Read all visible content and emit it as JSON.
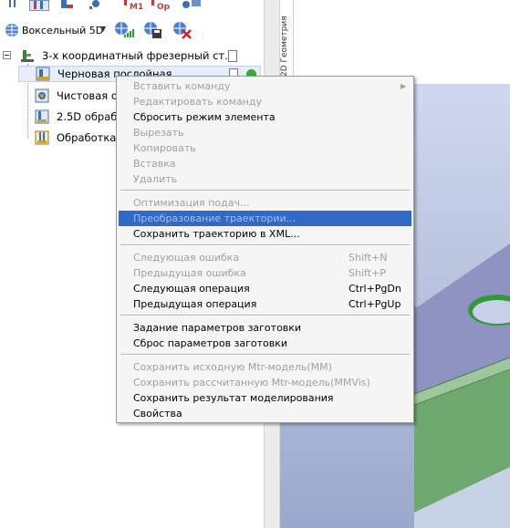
{
  "toolbar": {
    "voxel_label": "Воксельный 5D"
  },
  "tree": {
    "root": "3-х координатный фрезерный ст...",
    "items": [
      {
        "label": "Черновая послойная"
      },
      {
        "label": "Чистовая о"
      },
      {
        "label": "2.5D обраб"
      },
      {
        "label": "Обработка"
      }
    ]
  },
  "side_tab": {
    "label": "2D Геометрия"
  },
  "context_menu": {
    "items": [
      {
        "label": "Вставить команду",
        "shortcut": "",
        "enabled": false
      },
      {
        "label": "Редактировать команду",
        "shortcut": "",
        "enabled": false
      },
      {
        "label": "Сбросить режим элемента",
        "shortcut": "",
        "enabled": true
      },
      {
        "label": "Вырезать",
        "shortcut": "",
        "enabled": false
      },
      {
        "label": "Копировать",
        "shortcut": "",
        "enabled": false
      },
      {
        "label": "Вставка",
        "shortcut": "",
        "enabled": false
      },
      {
        "label": "Удалить",
        "shortcut": "",
        "enabled": false
      },
      {
        "label": "Оптимизация подач...",
        "shortcut": "",
        "enabled": false
      },
      {
        "label": "Преобразование траектории...",
        "shortcut": "",
        "enabled": false,
        "highlighted": true
      },
      {
        "label": "Сохранить траекторию в XML...",
        "shortcut": "",
        "enabled": true
      },
      {
        "label": "Следующая ошибка",
        "shortcut": "Shift+N",
        "enabled": false
      },
      {
        "label": "Предыдущая ошибка",
        "shortcut": "Shift+P",
        "enabled": false
      },
      {
        "label": "Следующая операция",
        "shortcut": "Ctrl+PgDn",
        "enabled": true
      },
      {
        "label": "Предыдущая операция",
        "shortcut": "Ctrl+PgUp",
        "enabled": true
      },
      {
        "label": "Задание параметров заготовки",
        "shortcut": "",
        "enabled": true
      },
      {
        "label": "Сброс параметров заготовки",
        "shortcut": "",
        "enabled": true
      },
      {
        "label": "Сохранить исходную Mtr-модель(MM)",
        "shortcut": "",
        "enabled": false
      },
      {
        "label": "Сохранить рассчитанную Mtr-модель(MMVis)",
        "shortcut": "",
        "enabled": false
      },
      {
        "label": "Сохранить результат моделирования",
        "shortcut": "",
        "enabled": true
      },
      {
        "label": "Свойства",
        "shortcut": "",
        "enabled": true
      }
    ]
  },
  "colors": {
    "highlight": "#3169c6",
    "disabled_text": "#a0a0a0",
    "viewport_top": "#cfd8ee",
    "part_top": "#8e93c2",
    "part_side": "#6fa86f",
    "hole_edge": "#2f9a3a"
  }
}
